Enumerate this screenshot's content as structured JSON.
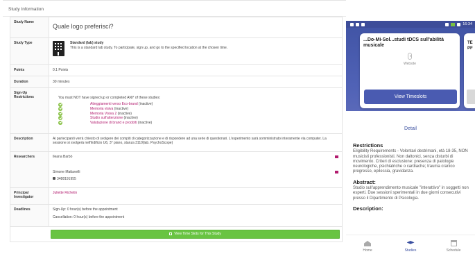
{
  "panel": {
    "title": "Study Information"
  },
  "study": {
    "name_label": "Study Name",
    "name_value": "Quale logo preferisci?",
    "type_label": "Study Type",
    "type_title": "Standard (lab) study",
    "type_desc": "This is a standard lab study. To participate, sign up, and go to the specified location at the chosen time.",
    "points_label": "Points",
    "points_value": "0.1 Points",
    "duration_label": "Duration",
    "duration_value": "30 minutes",
    "signup_label": "Sign-Up Restrictions",
    "signup_intro": "You must NOT have signed up or completed ANY of these studies:",
    "restrictions": [
      {
        "name": "Atteggiamenti verso Eco-brand",
        "status": "(inactive)"
      },
      {
        "name": "Memoria visiva",
        "status": "(inactive)"
      },
      {
        "name": "Memoria Visiva 2",
        "status": "(inactive)"
      },
      {
        "name": "Studio sull'attenzione",
        "status": "(inactive)"
      },
      {
        "name": "Valutazione di brand e prodotti",
        "status": "(inactive)"
      }
    ],
    "description_label": "Description",
    "description_value": "Ai partecipanti verrà chiesto di svolgere dei compiti di categorizzazione e di rispondere ad una serie di questionari. L'esperimento sarà somministrato interamente via computer. La sessione si svolgerà nell'Edificio U6, 3° piano, stanza 3110(lab. PsychoScope)",
    "researchers_label": "Researchers",
    "researcher_1": "Ileana Barbò",
    "researcher_2": "Simone Mattavelli",
    "researcher_2_phone": "3488191955",
    "pi_label": "Principal Investigator",
    "pi_value": "Juliette Richetin",
    "deadlines_label": "Deadlines",
    "deadline_signup": "Sign-Up: 0 hour(s) before the appointment",
    "deadline_cancel": "Cancellation: 0 hour(s) before the appointment",
    "timeslot_button": "View Time Slots for This Study"
  },
  "phone": {
    "status_time": "16:34",
    "card_title": "...Do-Mi-Sol...studi tDCS sull'abilità musicale",
    "card_site": "Website",
    "view_timeslots": "View Timeslots",
    "card2_title_line1": "TE",
    "card2_title_line2": "PF",
    "detail_link": "Detail",
    "restrictions_title": "Restrictions",
    "restrictions_text": "Eligibility Requirements - Volontari destrimani, età 18-35, NON musicisti professionisti. Non daltonici, senza disturbi di movimento. Criteri di esclusione: presenza di patologie neurologiche, psichiatriche o cardiache; trauma cranico pregresso, epilessia, gravidanza.",
    "abstract_title": "Abstract:",
    "abstract_text": "Studio sull'apprendimento musicale \"interattivo\" in soggetti non esperti. Due sessioni sperimentali in due giorni consecutivi presso il Dipartimento di Psicologia.",
    "description_title": "Description:",
    "nav": {
      "home": "Home",
      "studies": "Studies",
      "schedule": "Schedule"
    }
  }
}
